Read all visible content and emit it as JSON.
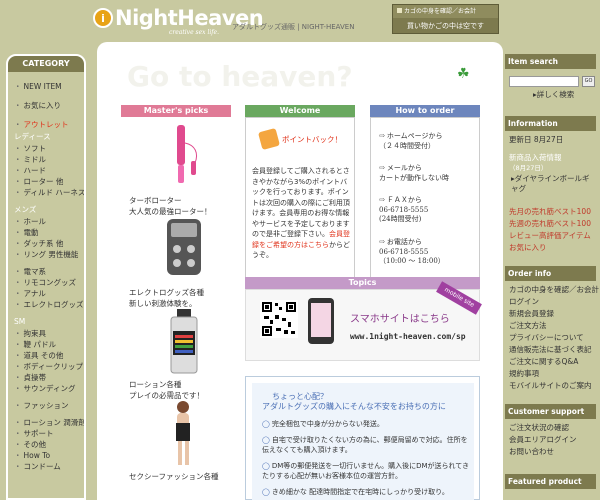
{
  "header": {
    "logo_letter": "i",
    "logo": "NightHeaven",
    "tagline": "creative sex life.",
    "description": "アダルトグッズ通販 | NIGHT-HEAVEN",
    "cart_link": "カゴの中身を確認／お会計",
    "cart_status": "買い物かごの中は空です"
  },
  "left": {
    "title": "CATEGORY",
    "top_items": [
      "NEW ITEM",
      "お気に入り",
      "アウトレット"
    ],
    "groups": [
      {
        "head": "レディース",
        "items": [
          "ソフト",
          "ミドル",
          "ハード",
          "ローター 他",
          "ディルド ハーネス"
        ]
      },
      {
        "head": "メンズ",
        "items": [
          "ホール",
          "電動",
          "ダッチ系 他",
          "リング 男性機能"
        ]
      },
      {
        "head": "",
        "items": [
          "電マ系",
          "リモコングッズ",
          "アナル",
          "エレクトログッズ"
        ]
      },
      {
        "head": "SM",
        "items": [
          "拘束具",
          "鞭 パドル",
          "道具 その他",
          "ボディークリップ",
          "貞操帯",
          "サウンディング"
        ]
      }
    ],
    "bottom_items": [
      "ファッション",
      "ローション 潤滑剤",
      "サポート",
      "その他",
      "How To",
      "コンドーム"
    ]
  },
  "main": {
    "hero": "Go to heaven?",
    "master_picks": {
      "head": "Master's picks",
      "items": [
        {
          "name": "ターボローター",
          "desc": "大人気の最強ローター！"
        },
        {
          "name": "エレクトログッズ各種",
          "desc": "新しい刺激体験を。"
        },
        {
          "name": "ローション各種",
          "desc": "プレイの必需品です！"
        },
        {
          "name": "セクシーファッション各種",
          "desc": ""
        }
      ]
    },
    "welcome": {
      "head": "Welcome",
      "point": "ポイントバック！",
      "text": "会員登録してご購入されるとさきやかながら3%のポイントバックを行っております。ポイントは次回の購入の際にご利用頂けます。会員専用のお得な情報やサービスを予定しておりますので是非ご登録下さい。",
      "link": "会員登録をご希望の方はこちら",
      "link_tail": "からどうぞ。"
    },
    "how": {
      "head": "How to order",
      "items": [
        {
          "t1": "ホームページから",
          "t2": "（２４時間受付）"
        },
        {
          "t1": "メールから",
          "t2": "カートが動作しない時"
        },
        {
          "t1": "ＦＡＸから",
          "t2": "06-6718-5555",
          "t3": "(24時間受付)"
        },
        {
          "t1": "お電話から",
          "t2": "06-6718-5555",
          "t3": "（10:00 ～ 18:00）"
        }
      ]
    },
    "topics": {
      "head": "Topics",
      "sub": "スマホサイトはこちら",
      "url": "www.1night-heaven.com/sp",
      "badge": "mobile site"
    },
    "worry": {
      "title1": "ちょっと心配？",
      "title2": "アダルトグッズの購入にそんな不安をお持ちの方に",
      "items": [
        "完全梱包で中身が分からない発送。",
        "自宅で受け取りたくない方の為に、郵便局留めで対応。住所を伝えなくても購入頂けます。",
        "DM等の郵便発送を一切行いません。購入後にDMが送られてきたりする心配が無いお客様本位の運営方針。",
        "きめ細かな 配達時間指定で在宅時にしっかり受け取り。"
      ]
    }
  },
  "right": {
    "search_title": "Item search",
    "search_btn": "GO",
    "search_detail": "詳しく検索",
    "info_title": "Information",
    "updated": "更新日 8月27日",
    "new_arrival": "新商品入荷情報",
    "new_date": "（8月27日）",
    "new_item": "ダイヤラインボールギャグ",
    "ranking": [
      "先月の売れ筋ベスト100",
      "先週の売れ筋ベスト100",
      "レビュー高評価アイテム",
      "お気に入り"
    ],
    "order_title": "Order info",
    "order_items": [
      "カゴの中身を確認／お会計",
      "ログイン",
      "新規会員登録",
      "ご注文方法",
      "プライバシーについて",
      "通信販売法に基づく表記",
      "ご注文に関するQ&A",
      "規約事項",
      "モバイルサイトのご案内"
    ],
    "support_title": "Customer support",
    "support_items": [
      "ご注文状況の確認",
      "会員エリアログイン",
      "お問い合わせ"
    ],
    "featured_title": "Featured product"
  }
}
